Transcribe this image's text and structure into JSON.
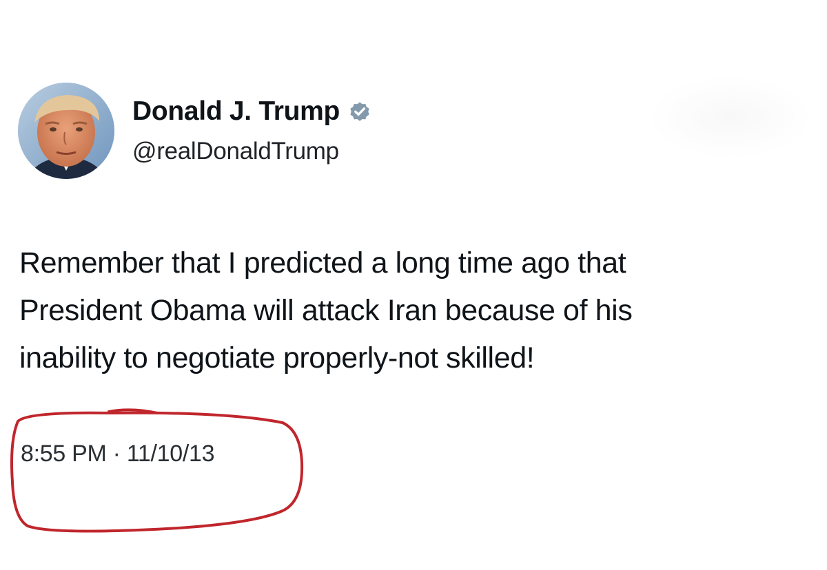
{
  "tweet": {
    "author": {
      "display_name": "Donald J. Trump",
      "handle": "@realDonaldTrump",
      "verified_icon": "verified-badge-icon",
      "verified_color": "#829aab"
    },
    "text_lines": [
      "Remember that I predicted a long time ago that",
      "President Obama will attack Iran because of his",
      "inability to negotiate properly-not skilled!"
    ],
    "timestamp": "8:55 PM · 11/10/13"
  },
  "colors": {
    "background": "#ffffff",
    "text": "#0f1419",
    "annotation_circle": "#c0262c"
  }
}
